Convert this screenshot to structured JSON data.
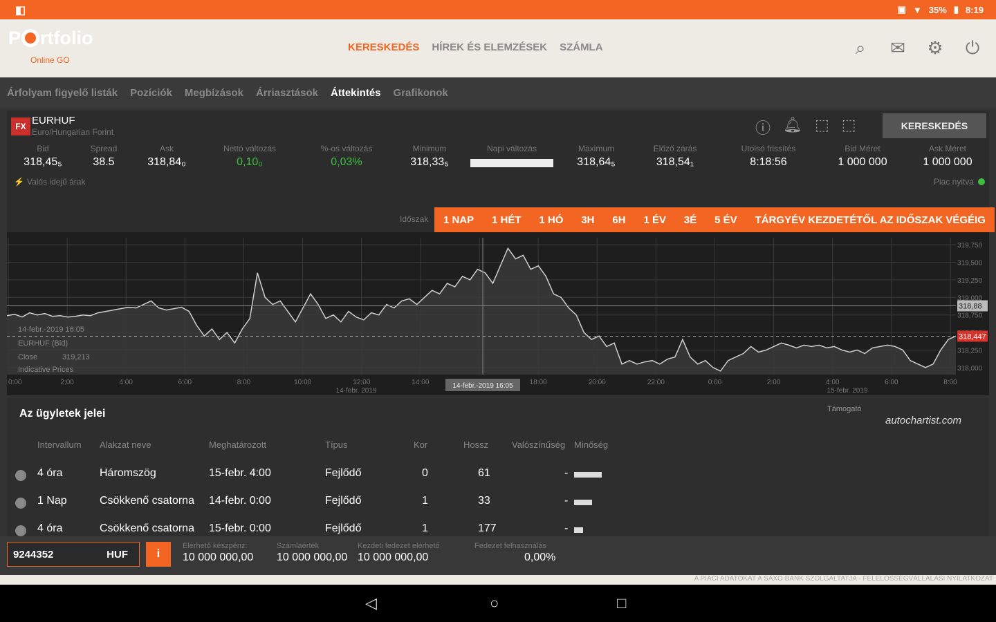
{
  "statusbar": {
    "left_icon": "notification-icon",
    "battery": "35%",
    "time": "8:19"
  },
  "brand": {
    "name_pre": "P",
    "name_post": "rtfolio",
    "sub": "Online GO"
  },
  "topnav": [
    "KERESKEDÉS",
    "HÍREK ÉS ELEMZÉSEK",
    "SZÁMLA"
  ],
  "subnav": [
    "Árfolyam figyelő listák",
    "Pozíciók",
    "Megbízások",
    "Árriasztások",
    "Áttekintés",
    "Grafikonok"
  ],
  "instrument": {
    "badge": "FX",
    "symbol": "EURHUF",
    "name": "Euro/Hungarian Forint",
    "trade_button": "KERESKEDÉS",
    "quotes": [
      {
        "label": "Bid",
        "value": "318,45₅"
      },
      {
        "label": "Spread",
        "value": "38.5"
      },
      {
        "label": "Ask",
        "value": "318,84₀"
      },
      {
        "label": "Nettó változás",
        "value": "0,10₀"
      },
      {
        "label": "%-os változás",
        "value": "0,03%"
      },
      {
        "label": "Minimum",
        "value": "318,33₅"
      },
      {
        "label": "Napi változás",
        "value": ""
      },
      {
        "label": "Maximum",
        "value": "318,64₅"
      },
      {
        "label": "Előző zárás",
        "value": "318,54₁"
      },
      {
        "label": "Utolsó frissítés",
        "value": "8:18:56"
      },
      {
        "label": "Bid Méret",
        "value": "1 000 000"
      },
      {
        "label": "Ask Méret",
        "value": "1 000 000"
      }
    ],
    "daily_change_fill": 1.0,
    "realtime": "Valós idejű árak",
    "market": "Piac nyitva"
  },
  "periods": {
    "label": "Időszak",
    "items": [
      "1 NAP",
      "1 HÉT",
      "1 HÓ",
      "3H",
      "6H",
      "1 ÉV",
      "3É",
      "5 ÉV",
      "TÁRGYÉV KEZDETÉTŐL AZ IDŐSZAK VÉGÉIG"
    ]
  },
  "chart_data": {
    "type": "area",
    "x_ticks": [
      "0:00",
      "2:00",
      "4:00",
      "6:00",
      "8:00",
      "10:00",
      "12:00",
      "14:00",
      "16:00",
      "18:00",
      "20:00",
      "22:00",
      "0:00",
      "2:00",
      "4:00",
      "6:00",
      "8:00"
    ],
    "x_date_labels": [
      "14-febr. 2019",
      "15-febr. 2019"
    ],
    "y_ticks": [
      "319,750",
      "319,500",
      "319,250",
      "319,000",
      "318,750",
      "318,500",
      "318,250",
      "318,000"
    ],
    "ylim": [
      317.9,
      319.85
    ],
    "current_marker": "318,447",
    "crosshair_marker": "318,88",
    "crosshair_label": "14-febr.-2019 16:05",
    "tooltip": {
      "date": "14-febr.-2019 16:05",
      "instrument": "EURHUF (Bid)",
      "close_label": "Close",
      "close_value": "319,213",
      "type": "Indicative Prices"
    },
    "series": [
      {
        "values": [
          318.74,
          318.76,
          318.72,
          318.78,
          318.75,
          318.77,
          318.73,
          318.74,
          318.72,
          318.73,
          318.75,
          318.74,
          318.78,
          318.8,
          318.82,
          318.84,
          318.86,
          318.85,
          318.9,
          318.95,
          318.85,
          318.82,
          318.84,
          318.86,
          318.8,
          318.6,
          318.45,
          318.55,
          318.4,
          318.5,
          318.35,
          318.55,
          318.7,
          319.35,
          319.0,
          318.9,
          318.95,
          318.8,
          318.65,
          318.85,
          319.05,
          318.9,
          318.7,
          318.75,
          318.65,
          318.8,
          318.72,
          318.68,
          318.78,
          318.75,
          318.9,
          318.85,
          318.95,
          318.98,
          318.9,
          319.0,
          319.1,
          319.05,
          319.2,
          319.15,
          319.3,
          319.25,
          319.4,
          319.35,
          319.2,
          319.45,
          319.7,
          319.55,
          319.6,
          319.4,
          319.45,
          319.3,
          319.05,
          319.0,
          318.85,
          318.75,
          318.5,
          318.4,
          318.45,
          318.3,
          318.35,
          318.05,
          318.1,
          318.05,
          318.08,
          318.1,
          318.05,
          318.12,
          318.15,
          318.4,
          318.15,
          318.05,
          318.1,
          318.0,
          317.95,
          318.1,
          318.15,
          318.2,
          318.3,
          318.22,
          318.25,
          318.3,
          318.35,
          318.32,
          318.28,
          318.32,
          318.3,
          318.32,
          318.28,
          318.3,
          318.25,
          318.22,
          318.25,
          318.2,
          318.28,
          318.3,
          318.32,
          318.3,
          318.25,
          318.1,
          318.05,
          318.0,
          318.05,
          318.25,
          318.4,
          318.45
        ]
      }
    ]
  },
  "signals": {
    "title": "Az ügyletek jelei",
    "sponsor_label": "Támogató",
    "sponsor": "autochartist.com",
    "headers": [
      "Intervallum",
      "Alakzat neve",
      "Meghatározott",
      "Típus",
      "Kor",
      "Hossz",
      "Valószínűség",
      "Minőség"
    ],
    "rows": [
      {
        "interval": "4 óra",
        "pattern": "Háromszög",
        "identified": "15-febr. 4:00",
        "type": "Fejlődő",
        "age": "0",
        "length": "61",
        "probability": "-",
        "quality": 0.9
      },
      {
        "interval": "1 Nap",
        "pattern": "Csökkenő csatorna",
        "identified": "14-febr. 0:00",
        "type": "Fejlődő",
        "age": "1",
        "length": "33",
        "probability": "-",
        "quality": 0.6
      },
      {
        "interval": "4 óra",
        "pattern": "Csökkenő csatorna",
        "identified": "15-febr. 0:00",
        "type": "Fejlődő",
        "age": "1",
        "length": "177",
        "probability": "-",
        "quality": 0.3
      }
    ]
  },
  "footer": {
    "account": "9244352",
    "currency": "HUF",
    "info": "i",
    "stats": [
      {
        "label": "Elérhető készpénz:",
        "value": "10 000 000,00"
      },
      {
        "label": "Számlaérték",
        "value": "10 000 000,00"
      },
      {
        "label": "Kezdeti fedezet elérhető",
        "value": "10 000 000,00"
      },
      {
        "label": "Fedezet felhasználás",
        "value": "0,00%"
      }
    ],
    "disclaimer": "A PIACI ADATOKAT A SAXO BANK SZOLGÁLTATJA · FELELŐSSÉGVÁLLALÁSI NYILATKOZAT"
  }
}
